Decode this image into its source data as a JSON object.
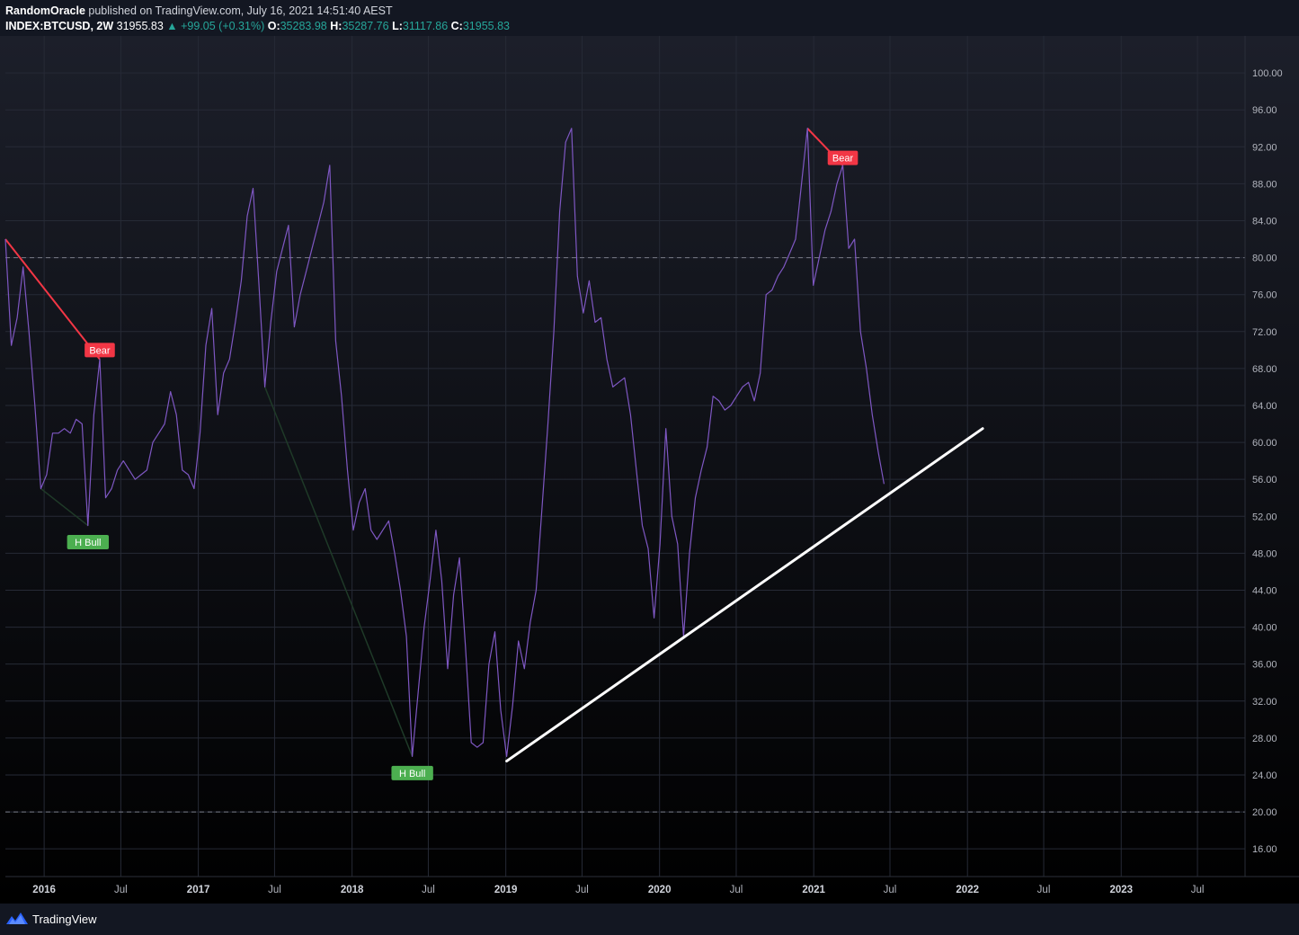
{
  "header": {
    "author": "RandomOracle",
    "published": "published on TradingView.com, July 16, 2021 14:51:40 AEST"
  },
  "ohlc": {
    "symbol": "INDEX:BTCUSD, 2W",
    "price": "31955.83",
    "change": "▲ +99.05 (+0.31%)",
    "o_label": "O:",
    "o": "35283.98",
    "h_label": "H:",
    "h": "35287.76",
    "l_label": "L:",
    "l": "31117.86",
    "c_label": "C:",
    "c": "31955.83"
  },
  "footer": {
    "brand": "TradingView",
    "logo_icon": "tradingview-logo-icon"
  },
  "colors": {
    "background": "#131722",
    "rsi_line": "#7e57c2",
    "bear": "#f23645",
    "bull": "#4caf50",
    "trendline": "#ffffff",
    "value_text": "#26a69a"
  },
  "chart_data": {
    "type": "line",
    "y_scale": "linear",
    "ylim": [
      13,
      104
    ],
    "x_range": [
      "2015-10-01",
      "2023-10-22"
    ],
    "grid": true,
    "y_ticks": [
      "16.00",
      "20.00",
      "24.00",
      "28.00",
      "32.00",
      "36.00",
      "40.00",
      "44.00",
      "48.00",
      "52.00",
      "56.00",
      "60.00",
      "64.00",
      "68.00",
      "72.00",
      "76.00",
      "80.00",
      "84.00",
      "88.00",
      "92.00",
      "96.00",
      "100.00"
    ],
    "x_ticks": [
      {
        "label": "2016",
        "date": "2016-01-01",
        "bold": true
      },
      {
        "label": "Jul",
        "date": "2016-07-01",
        "bold": false
      },
      {
        "label": "2017",
        "date": "2017-01-01",
        "bold": true
      },
      {
        "label": "Jul",
        "date": "2017-07-01",
        "bold": false
      },
      {
        "label": "2018",
        "date": "2018-01-01",
        "bold": true
      },
      {
        "label": "Jul",
        "date": "2018-07-01",
        "bold": false
      },
      {
        "label": "2019",
        "date": "2019-01-01",
        "bold": true
      },
      {
        "label": "Jul",
        "date": "2019-07-01",
        "bold": false
      },
      {
        "label": "2020",
        "date": "2020-01-01",
        "bold": true
      },
      {
        "label": "Jul",
        "date": "2020-07-01",
        "bold": false
      },
      {
        "label": "2021",
        "date": "2021-01-01",
        "bold": true
      },
      {
        "label": "Jul",
        "date": "2021-07-01",
        "bold": false
      },
      {
        "label": "2022",
        "date": "2022-01-01",
        "bold": true
      },
      {
        "label": "Jul",
        "date": "2022-07-01",
        "bold": false
      },
      {
        "label": "2023",
        "date": "2023-01-01",
        "bold": true
      },
      {
        "label": "Jul",
        "date": "2023-07-01",
        "bold": false
      }
    ],
    "bands": [
      80,
      20
    ],
    "series": [
      {
        "values": [
          [
            "2015-10-01",
            82
          ],
          [
            "2015-10-15",
            70.5
          ],
          [
            "2015-10-29",
            73.5
          ],
          [
            "2015-11-12",
            79
          ],
          [
            "2015-11-26",
            72
          ],
          [
            "2015-12-10",
            64
          ],
          [
            "2015-12-24",
            55
          ],
          [
            "2016-01-07",
            56.5
          ],
          [
            "2016-01-21",
            61
          ],
          [
            "2016-02-04",
            61
          ],
          [
            "2016-02-18",
            61.5
          ],
          [
            "2016-03-03",
            61
          ],
          [
            "2016-03-17",
            62.5
          ],
          [
            "2016-03-31",
            62
          ],
          [
            "2016-04-14",
            51
          ],
          [
            "2016-04-28",
            63
          ],
          [
            "2016-05-12",
            69
          ],
          [
            "2016-05-26",
            54
          ],
          [
            "2016-06-09",
            55
          ],
          [
            "2016-06-23",
            57
          ],
          [
            "2016-07-07",
            58
          ],
          [
            "2016-07-21",
            57
          ],
          [
            "2016-08-04",
            56
          ],
          [
            "2016-08-18",
            56.5
          ],
          [
            "2016-09-01",
            57
          ],
          [
            "2016-09-15",
            60
          ],
          [
            "2016-09-29",
            61
          ],
          [
            "2016-10-13",
            62
          ],
          [
            "2016-10-27",
            65.5
          ],
          [
            "2016-11-10",
            63
          ],
          [
            "2016-11-24",
            57
          ],
          [
            "2016-12-08",
            56.5
          ],
          [
            "2016-12-22",
            55
          ],
          [
            "2017-01-05",
            61
          ],
          [
            "2017-01-19",
            70.5
          ],
          [
            "2017-02-02",
            74.5
          ],
          [
            "2017-02-16",
            63
          ],
          [
            "2017-03-02",
            67.5
          ],
          [
            "2017-03-16",
            69
          ],
          [
            "2017-03-30",
            73
          ],
          [
            "2017-04-13",
            77.5
          ],
          [
            "2017-04-27",
            84.5
          ],
          [
            "2017-05-11",
            87.5
          ],
          [
            "2017-05-25",
            77
          ],
          [
            "2017-06-08",
            66
          ],
          [
            "2017-06-22",
            73
          ],
          [
            "2017-07-06",
            78.5
          ],
          [
            "2017-07-20",
            81
          ],
          [
            "2017-08-03",
            83.5
          ],
          [
            "2017-08-17",
            72.5
          ],
          [
            "2017-08-31",
            76
          ],
          [
            "2017-09-14",
            78.5
          ],
          [
            "2017-09-28",
            81
          ],
          [
            "2017-10-12",
            83.5
          ],
          [
            "2017-10-26",
            86
          ],
          [
            "2017-11-09",
            90
          ],
          [
            "2017-11-23",
            71
          ],
          [
            "2017-12-07",
            65
          ],
          [
            "2017-12-21",
            57
          ],
          [
            "2018-01-04",
            50.5
          ],
          [
            "2018-01-18",
            53.5
          ],
          [
            "2018-02-01",
            55
          ],
          [
            "2018-02-15",
            50.5
          ],
          [
            "2018-03-01",
            49.5
          ],
          [
            "2018-03-15",
            50.5
          ],
          [
            "2018-03-29",
            51.5
          ],
          [
            "2018-04-12",
            48
          ],
          [
            "2018-04-26",
            44
          ],
          [
            "2018-05-10",
            39
          ],
          [
            "2018-05-24",
            26
          ],
          [
            "2018-06-07",
            33
          ],
          [
            "2018-06-21",
            40
          ],
          [
            "2018-07-05",
            45
          ],
          [
            "2018-07-19",
            50.5
          ],
          [
            "2018-08-02",
            45
          ],
          [
            "2018-08-16",
            35.5
          ],
          [
            "2018-08-30",
            43.5
          ],
          [
            "2018-09-13",
            47.5
          ],
          [
            "2018-09-27",
            38
          ],
          [
            "2018-10-11",
            27.5
          ],
          [
            "2018-10-25",
            27
          ],
          [
            "2018-11-08",
            27.5
          ],
          [
            "2018-11-22",
            36
          ],
          [
            "2018-12-06",
            39.5
          ],
          [
            "2018-12-20",
            31
          ],
          [
            "2019-01-03",
            26
          ],
          [
            "2019-01-17",
            31.5
          ],
          [
            "2019-01-31",
            38.5
          ],
          [
            "2019-02-14",
            35.5
          ],
          [
            "2019-02-28",
            40.5
          ],
          [
            "2019-03-14",
            44
          ],
          [
            "2019-03-28",
            53
          ],
          [
            "2019-04-11",
            62
          ],
          [
            "2019-04-25",
            72
          ],
          [
            "2019-05-09",
            85
          ],
          [
            "2019-05-23",
            92.5
          ],
          [
            "2019-06-06",
            94
          ],
          [
            "2019-06-20",
            78
          ],
          [
            "2019-07-04",
            74
          ],
          [
            "2019-07-18",
            77.5
          ],
          [
            "2019-08-01",
            73
          ],
          [
            "2019-08-15",
            73.5
          ],
          [
            "2019-08-29",
            69
          ],
          [
            "2019-09-12",
            66
          ],
          [
            "2019-09-26",
            66.5
          ],
          [
            "2019-10-10",
            67
          ],
          [
            "2019-10-24",
            63
          ],
          [
            "2019-11-07",
            57
          ],
          [
            "2019-11-21",
            51
          ],
          [
            "2019-12-05",
            48.5
          ],
          [
            "2019-12-19",
            41
          ],
          [
            "2020-01-02",
            49
          ],
          [
            "2020-01-16",
            61.5
          ],
          [
            "2020-01-30",
            52
          ],
          [
            "2020-02-13",
            49
          ],
          [
            "2020-02-27",
            39
          ],
          [
            "2020-03-12",
            48
          ],
          [
            "2020-03-26",
            54
          ],
          [
            "2020-04-09",
            57
          ],
          [
            "2020-04-23",
            59.5
          ],
          [
            "2020-05-07",
            65
          ],
          [
            "2020-05-21",
            64.5
          ],
          [
            "2020-06-04",
            63.5
          ],
          [
            "2020-06-18",
            64
          ],
          [
            "2020-07-02",
            65
          ],
          [
            "2020-07-16",
            66
          ],
          [
            "2020-07-30",
            66.5
          ],
          [
            "2020-08-13",
            64.5
          ],
          [
            "2020-08-27",
            67.5
          ],
          [
            "2020-09-10",
            76
          ],
          [
            "2020-09-24",
            76.5
          ],
          [
            "2020-10-08",
            78
          ],
          [
            "2020-10-22",
            79
          ],
          [
            "2020-11-05",
            80.5
          ],
          [
            "2020-11-19",
            82
          ],
          [
            "2020-12-03",
            88
          ],
          [
            "2020-12-17",
            94
          ],
          [
            "2020-12-31",
            77
          ],
          [
            "2021-01-14",
            80
          ],
          [
            "2021-01-28",
            83
          ],
          [
            "2021-02-11",
            85
          ],
          [
            "2021-02-25",
            88
          ],
          [
            "2021-03-11",
            90
          ],
          [
            "2021-03-25",
            81
          ],
          [
            "2021-04-08",
            82
          ],
          [
            "2021-04-22",
            72
          ],
          [
            "2021-05-06",
            68
          ],
          [
            "2021-05-20",
            63
          ],
          [
            "2021-06-03",
            59
          ],
          [
            "2021-06-17",
            55.5
          ]
        ]
      }
    ],
    "divergences": [
      {
        "type": "bear",
        "label": "Bear",
        "from": [
          "2015-10-01",
          82
        ],
        "to": [
          "2016-05-12",
          69
        ]
      },
      {
        "type": "bull",
        "label": "H Bull",
        "from": [
          "2015-12-24",
          55
        ],
        "to": [
          "2016-04-14",
          51
        ]
      },
      {
        "type": "bull",
        "label": "H Bull",
        "from": [
          "2017-06-08",
          66
        ],
        "to": [
          "2018-05-24",
          26
        ]
      },
      {
        "type": "bear",
        "label": "Bear",
        "from": [
          "2020-12-17",
          94
        ],
        "to": [
          "2021-03-11",
          90
        ]
      }
    ],
    "trendline": {
      "from": [
        "2019-01-03",
        25.5
      ],
      "to": [
        "2022-02-06",
        61.5
      ]
    },
    "labels": [
      {
        "text": "Bear",
        "type": "bear",
        "at": [
          "2016-05-12",
          70
        ]
      },
      {
        "text": "H Bull",
        "type": "bull",
        "at": [
          "2016-04-14",
          49.2
        ]
      },
      {
        "text": "H Bull",
        "type": "bull",
        "at": [
          "2018-05-24",
          24.2
        ]
      },
      {
        "text": "Bear",
        "type": "bear",
        "at": [
          "2021-03-11",
          90.8
        ]
      }
    ]
  }
}
